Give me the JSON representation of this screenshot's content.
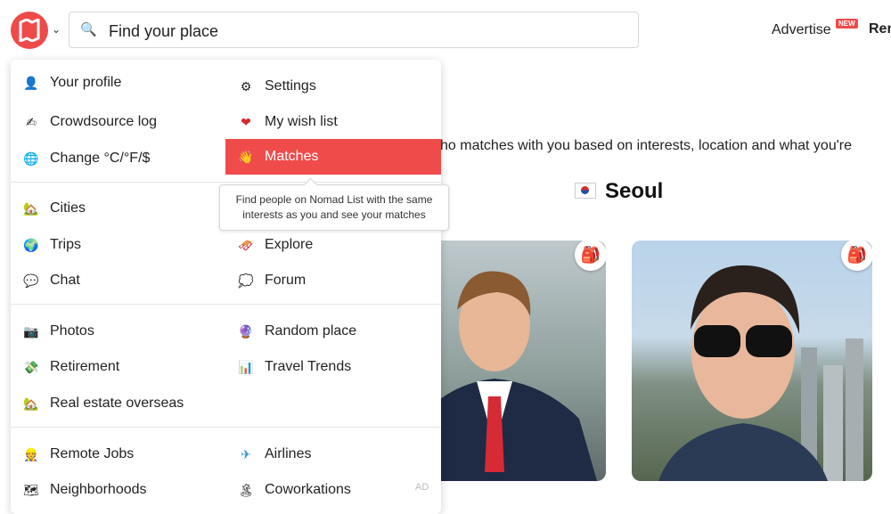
{
  "search": {
    "placeholder": "Find your place"
  },
  "header": {
    "advertise": "Advertise",
    "new_badge": "NEW",
    "rent": "Rent"
  },
  "background": {
    "intro": "ho matches with you based on interests, location and what you're",
    "city": "Seoul"
  },
  "menu": {
    "left": [
      {
        "label": "Your profile",
        "icon": "avatar-icon"
      },
      {
        "label": "Crowdsource log",
        "icon": "writing-hand-icon"
      },
      {
        "label": "Change °C/°F/$",
        "icon": "globe-icon"
      },
      {
        "label": "Cities",
        "icon": "city-icon"
      },
      {
        "label": "Trips",
        "icon": "earth-icon"
      },
      {
        "label": "Chat",
        "icon": "speech-bubble-icon"
      },
      {
        "label": "Photos",
        "icon": "camera-icon"
      },
      {
        "label": "Retirement",
        "icon": "money-icon"
      },
      {
        "label": "Real estate overseas",
        "icon": "house-icon"
      },
      {
        "label": "Remote Jobs",
        "icon": "worker-icon"
      },
      {
        "label": "Neighborhoods",
        "icon": "map-icon"
      }
    ],
    "right": [
      {
        "label": "Settings",
        "icon": "gear-icon"
      },
      {
        "label": "My wish list",
        "icon": "heart-icon"
      },
      {
        "label": "Matches",
        "icon": "waving-hand-icon",
        "active": true
      },
      {
        "label": "Explore",
        "icon": "sled-icon"
      },
      {
        "label": "Forum",
        "icon": "thought-bubble-icon"
      },
      {
        "label": "Random place",
        "icon": "crystal-ball-icon"
      },
      {
        "label": "Travel Trends",
        "icon": "bar-chart-icon"
      },
      {
        "label": "Airlines",
        "icon": "airplane-icon"
      },
      {
        "label": "Coworkations",
        "icon": "island-icon"
      }
    ],
    "tooltip": "Find people on Nomad List with the same interests as you and see your matches",
    "ad_label": "AD"
  },
  "colors": {
    "accent": "#f04b4b"
  }
}
